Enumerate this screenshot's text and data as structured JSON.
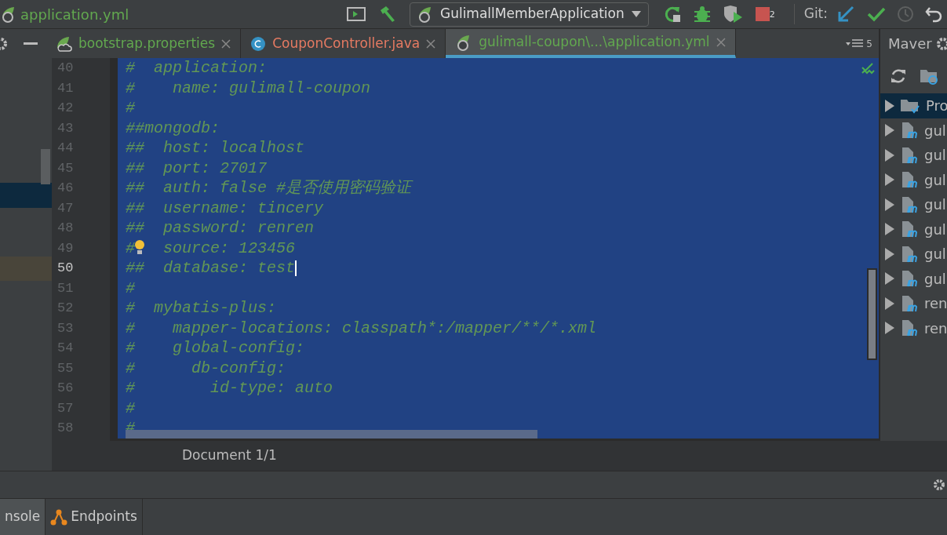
{
  "toolbar": {
    "file_name": "application.yml",
    "run_config": "GulimallMemberApplication",
    "stop_count": "2",
    "git_label": "Git:"
  },
  "tabs": [
    {
      "label": "bootstrap.properties",
      "kind": "spring-cloud",
      "selected": false
    },
    {
      "label": "CouponController.java",
      "kind": "java",
      "selected": false
    },
    {
      "label": "gulimall-coupon\\...\\application.yml",
      "kind": "spring",
      "selected": true
    }
  ],
  "tab_count": "5",
  "editor": {
    "lines": [
      {
        "number": "40",
        "text": "#  application:",
        "current": false
      },
      {
        "number": "41",
        "text": "#    name: gulimall-coupon",
        "current": false
      },
      {
        "number": "42",
        "text": "#",
        "current": false
      },
      {
        "number": "43",
        "text": "##mongodb:",
        "current": false
      },
      {
        "number": "44",
        "text": "##  host: localhost",
        "current": false
      },
      {
        "number": "45",
        "text": "##  port: 27017",
        "current": false
      },
      {
        "number": "46",
        "text": "##  auth: false #是否使用密码验证",
        "current": false
      },
      {
        "number": "47",
        "text": "##  username: tincery",
        "current": false
      },
      {
        "number": "48",
        "text": "##  password: renren",
        "current": false
      },
      {
        "number": "49",
        "prefix": "#",
        "text": "  source: 123456",
        "kind": "bulb",
        "current": false
      },
      {
        "number": "50",
        "text": "##  database: test",
        "current": true
      },
      {
        "number": "51",
        "text": "#",
        "current": false
      },
      {
        "number": "52",
        "text": "#  mybatis-plus:",
        "current": false
      },
      {
        "number": "53",
        "text": "#    mapper-locations: classpath*:/mapper/**/*.xml",
        "current": false
      },
      {
        "number": "54",
        "text": "#    global-config:",
        "current": false
      },
      {
        "number": "55",
        "text": "#      db-config:",
        "current": false
      },
      {
        "number": "56",
        "text": "#        id-type: auto",
        "current": false
      },
      {
        "number": "57",
        "text": "#",
        "current": false
      },
      {
        "number": "58",
        "text": "#",
        "current": false
      }
    ]
  },
  "status": "Document 1/1",
  "maven": {
    "title": "Maver",
    "items": [
      {
        "label": "Pro",
        "kind": "folder",
        "selected": true
      },
      {
        "label": "gul",
        "kind": "module",
        "selected": false
      },
      {
        "label": "gul",
        "kind": "module",
        "selected": false
      },
      {
        "label": "gul",
        "kind": "module",
        "selected": false
      },
      {
        "label": "gul",
        "kind": "module",
        "selected": false
      },
      {
        "label": "gul",
        "kind": "module",
        "selected": false
      },
      {
        "label": "gul",
        "kind": "module",
        "selected": false
      },
      {
        "label": "gul",
        "kind": "module",
        "selected": false
      },
      {
        "label": "ren",
        "kind": "module",
        "selected": false
      },
      {
        "label": "ren",
        "kind": "module",
        "selected": false
      }
    ]
  },
  "tool_tabs": [
    {
      "label": "nsole",
      "kind": "plain",
      "selected": true
    },
    {
      "label": "Endpoints",
      "kind": "endpoints",
      "selected": false
    }
  ]
}
